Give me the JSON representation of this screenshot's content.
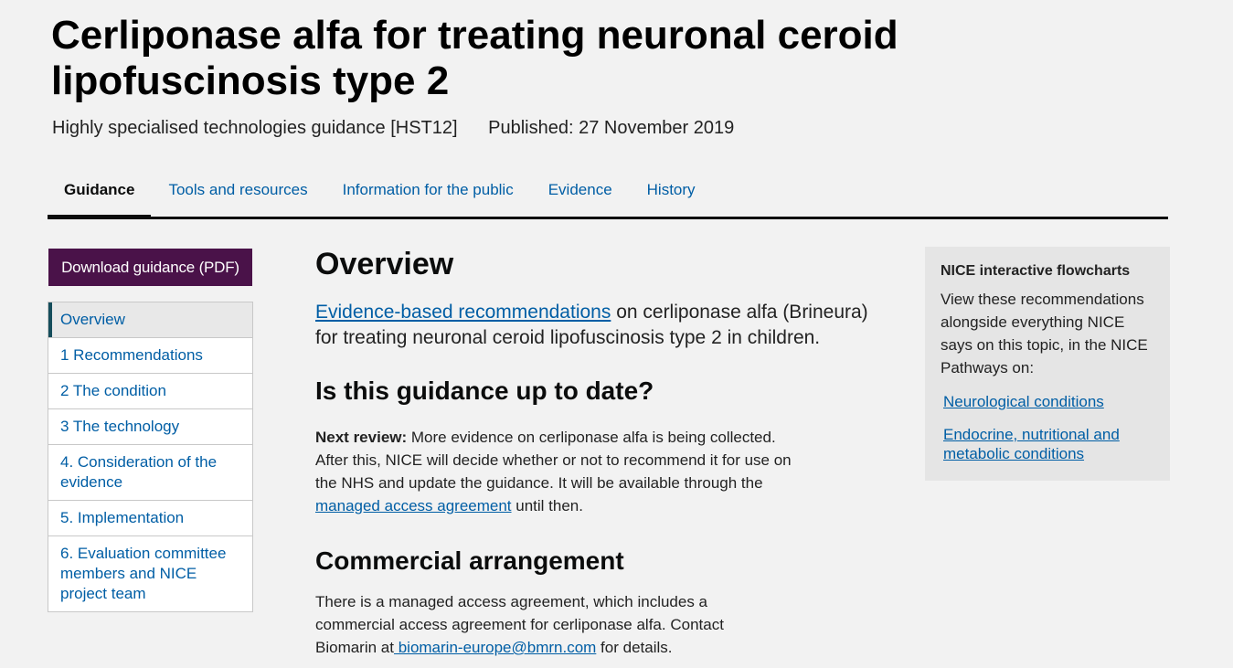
{
  "header": {
    "title": "Cerliponase alfa for treating neuronal ceroid lipofuscinosis type 2",
    "guidance_type": "Highly specialised technologies guidance [HST12]",
    "published": "Published: 27 November 2019"
  },
  "tabs": [
    {
      "label": "Guidance",
      "active": true
    },
    {
      "label": "Tools and resources",
      "active": false
    },
    {
      "label": "Information for the public",
      "active": false
    },
    {
      "label": "Evidence",
      "active": false
    },
    {
      "label": "History",
      "active": false
    }
  ],
  "sidebar": {
    "download_label": "Download guidance (PDF)",
    "items": [
      {
        "label": "Overview"
      },
      {
        "label": "1 Recommendations"
      },
      {
        "label": "2 The condition"
      },
      {
        "label": "3 The technology"
      },
      {
        "label": "4. Consideration of the evidence"
      },
      {
        "label": "5. Implementation"
      },
      {
        "label": "6. Evaluation committee members and NICE project team"
      }
    ]
  },
  "content": {
    "overview_heading": "Overview",
    "overview_link": "Evidence-based recommendations",
    "overview_text": " on cerliponase alfa (Brineura) for treating neuronal ceroid lipofuscinosis type 2 in children.",
    "uptodate_heading": "Is this guidance up to date?",
    "review_label": "Next review:",
    "review_text": " More evidence on cerliponase alfa is being collected. After this, NICE will decide whether or not to recommend it for use on the NHS and update the guidance. It will be available through the ",
    "review_link": "managed access agreement",
    "review_tail": " until then.",
    "commercial_heading": "Commercial arrangement",
    "commercial_text": "There is a managed access agreement, which includes a commercial access agreement for cerliponase alfa. Contact Biomarin at",
    "commercial_link": " biomarin-europe@bmrn.com",
    "commercial_tail": " for details."
  },
  "aside": {
    "title": "NICE interactive flowcharts",
    "text": "View these recommendations alongside everything NICE says on this topic, in the NICE Pathways on:",
    "links": [
      "Neurological conditions",
      "Endocrine, nutritional and metabolic conditions"
    ]
  },
  "colors": {
    "background": "#f2f2f2",
    "link": "#005ea5",
    "download_button": "#4a1249",
    "active_nav_border": "#154d5b"
  }
}
